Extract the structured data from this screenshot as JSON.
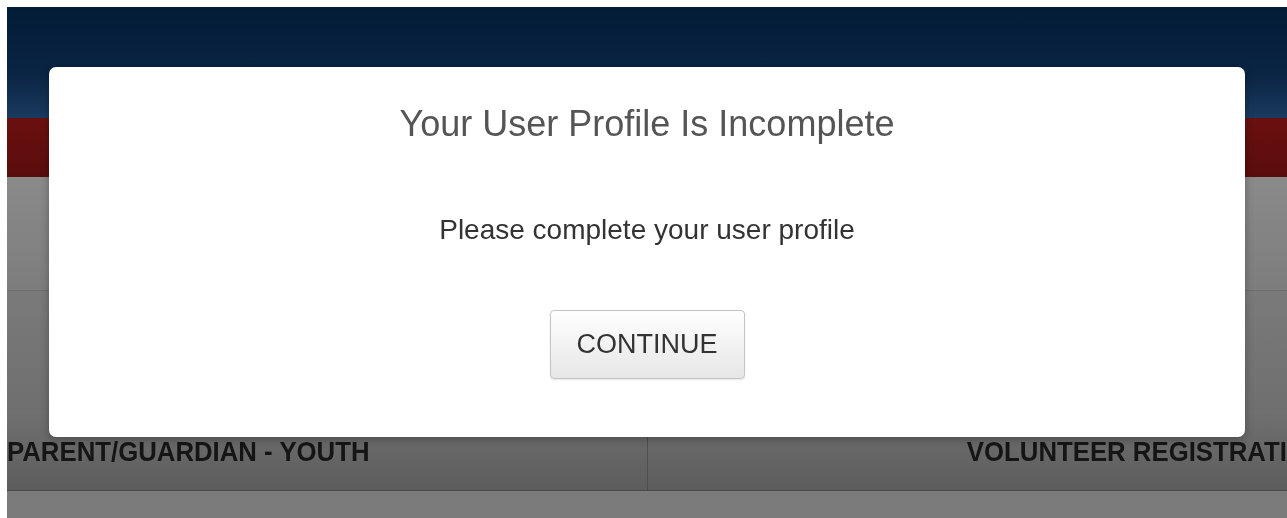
{
  "background": {
    "tabs": [
      {
        "label": "PARENT/GUARDIAN - YOUTH"
      },
      {
        "label": "VOLUNTEER REGISTRATI"
      }
    ]
  },
  "dialog": {
    "title": "Your User Profile Is Incomplete",
    "message": "Please complete your user profile",
    "button": "CONTINUE"
  }
}
